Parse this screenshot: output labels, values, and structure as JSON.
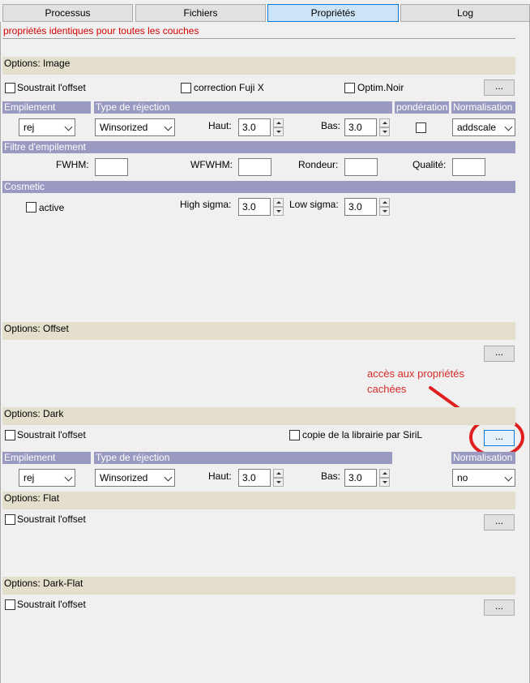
{
  "tabs": [
    "Processus",
    "Fichiers",
    "Propriétés",
    "Log"
  ],
  "warning": "propriétés identiques pour toutes les couches",
  "image": {
    "title": "Options: Image",
    "subtract_offset": "Soustrait l'offset",
    "fuji": "correction Fuji X",
    "optim": "Optim.Noir",
    "more": "...",
    "headers": {
      "stack": "Empilement",
      "reject": "Type de réjection",
      "weight": "pondération",
      "norm": "Normalisation"
    },
    "stack_value": "rej",
    "reject_value": "Winsorized",
    "haut_label": "Haut:",
    "haut_value": "3.0",
    "bas_label": "Bas:",
    "bas_value": "3.0",
    "norm_value": "addscale",
    "filter_header": "Filtre d'empilement",
    "fwhm": "FWHM:",
    "wfwhm": "WFWHM:",
    "roundness": "Rondeur:",
    "quality": "Qualité:",
    "cosmetic_header": "Cosmetic",
    "active": "active",
    "high_sigma": "High sigma:",
    "high_value": "3.0",
    "low_sigma": "Low sigma:",
    "low_value": "3.0"
  },
  "offset": {
    "title": "Options: Offset",
    "more": "..."
  },
  "dark": {
    "title": "Options: Dark",
    "subtract_offset": "Soustrait l'offset",
    "copy_lib": "copie de la librairie par SiriL",
    "more": "...",
    "headers": {
      "stack": "Empilement",
      "reject": "Type de réjection",
      "norm": "Normalisation"
    },
    "stack_value": "rej",
    "reject_value": "Winsorized",
    "haut_label": "Haut:",
    "haut_value": "3.0",
    "bas_label": "Bas:",
    "bas_value": "3.0",
    "norm_value": "no"
  },
  "flat": {
    "title": "Options: Flat",
    "subtract_offset": "Soustrait l'offset",
    "more": "..."
  },
  "darkflat": {
    "title": "Options: Dark-Flat",
    "subtract_offset": "Soustrait l'offset",
    "more": "..."
  },
  "annotation": {
    "line1": "accès aux  propriétés",
    "line2": "cachées",
    "color": "#e02020"
  }
}
